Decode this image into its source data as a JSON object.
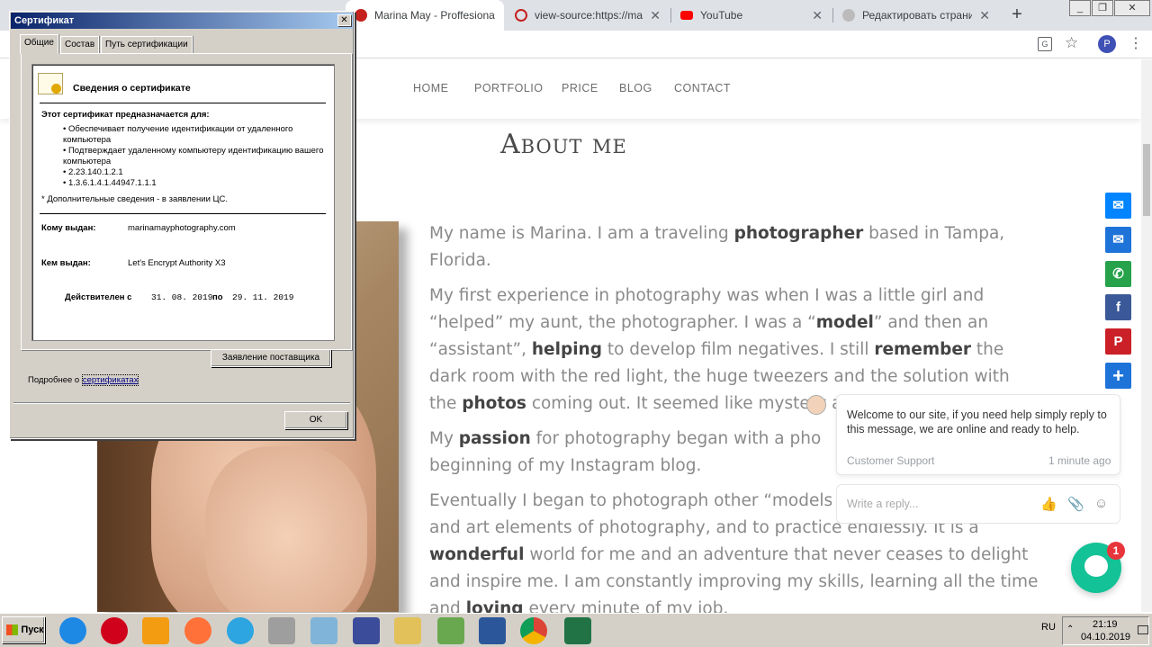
{
  "browser": {
    "tabs": [
      {
        "title": "Marina May - Proffesional P",
        "active": true,
        "color": "#c5221f"
      },
      {
        "title": "view-source:https://marina",
        "active": false,
        "color": "#c5221f"
      },
      {
        "title": "YouTube",
        "active": false,
        "color": "#ff0000"
      },
      {
        "title": "Редактировать страницу",
        "active": false,
        "color": "#888888"
      }
    ],
    "profile_initial": "P"
  },
  "site": {
    "nav": [
      "HOME",
      "PORTFOLIO",
      "PRICE",
      "BLOG",
      "CONTACT"
    ],
    "about_title": "About me",
    "p1": [
      "My name is Marina. I am a traveling ",
      "photographer",
      " based in Tampa, Florida."
    ],
    "p2": [
      "My first experience in photography was when I  was a little girl and “helped” my aunt, the photographer. I was a “",
      "model",
      "” and then an “assistant”, ",
      "helping",
      " to develop film negatives. I still ",
      "remember",
      " the dark room with the red light, the huge tweezers and the solution with the ",
      "photos",
      " coming out. It seemed like mystery ar"
    ],
    "p3": [
      "My ",
      "passion",
      " for photography began with a pho",
      "",
      " beginning of my Instagram blog."
    ],
    "p4": [
      "Eventually I began to photograph other “models",
      "and art elements of photography, and to practice endlessly. It is a ",
      "wonderful",
      " world for me and an adventure that never ceases to delight and inspire me. I am constantly improving my skills, learning all the time and ",
      "loving",
      " every minute of my job."
    ]
  },
  "share_buttons": [
    {
      "name": "messenger",
      "color": "#0084ff",
      "glyph": "✉"
    },
    {
      "name": "email",
      "color": "#1e73d8",
      "glyph": "✉"
    },
    {
      "name": "whatsapp",
      "color": "#25a24a",
      "glyph": "✆"
    },
    {
      "name": "facebook",
      "color": "#3b5998",
      "glyph": "f"
    },
    {
      "name": "pinterest",
      "color": "#cb2027",
      "glyph": "P"
    },
    {
      "name": "share",
      "color": "#1e73d8",
      "glyph": "+"
    }
  ],
  "chat": {
    "message": "Welcome to our site, if you need help simply reply to this message, we are online and ready to help.",
    "sender": "Customer Support",
    "time": "1 minute ago",
    "reply_placeholder": "Write a reply...",
    "badge": "1"
  },
  "dialog": {
    "title": "Сертификат",
    "tabs": [
      "Общие",
      "Состав",
      "Путь сертификации"
    ],
    "heading": "Сведения о сертификате",
    "purpose_title": "Этот сертификат предназначается для:",
    "purposes": [
      "• Обеспечивает получение идентификации от удаленного компьютера",
      "• Подтверждает удаленному компьютеру идентификацию вашего компьютера",
      "• 2.23.140.1.2.1",
      "• 1.3.6.1.4.1.44947.1.1.1"
    ],
    "note": "* Дополнительные сведения - в заявлении ЦС.",
    "issued_to_label": "Кому выдан:",
    "issued_to": "marinamayphotography.com",
    "issued_by_label": "Кем выдан:",
    "issued_by": "Let's Encrypt Authority X3",
    "valid_label": "Действителен с",
    "valid_from": "31. 08. 2019",
    "valid_to_label": "по",
    "valid_to": "29. 11. 2019",
    "issuer_statement": "Заявление поставщика",
    "more_info": "Подробнее о ",
    "more_link": "сертификатах",
    "ok": "OK"
  },
  "taskbar": {
    "start": "Пуск",
    "lang": "RU",
    "time": "21:19",
    "date": "04.10.2019",
    "icons": [
      {
        "name": "ie",
        "color": "#1e88e5"
      },
      {
        "name": "opera",
        "color": "#d0021b"
      },
      {
        "name": "media",
        "color": "#f39c12"
      },
      {
        "name": "firefox",
        "color": "#ff7139"
      },
      {
        "name": "telegram",
        "color": "#2ca5e0"
      },
      {
        "name": "calculator",
        "color": "#9e9e9e"
      },
      {
        "name": "notepad",
        "color": "#80b4d8"
      },
      {
        "name": "save",
        "color": "#3b4c9b"
      },
      {
        "name": "explorer",
        "color": "#e2c15a"
      },
      {
        "name": "excel-doc",
        "color": "#6aa84f"
      },
      {
        "name": "word",
        "color": "#2b579a"
      },
      {
        "name": "chrome",
        "color": "#db4437"
      },
      {
        "name": "excel",
        "color": "#217346"
      }
    ]
  }
}
